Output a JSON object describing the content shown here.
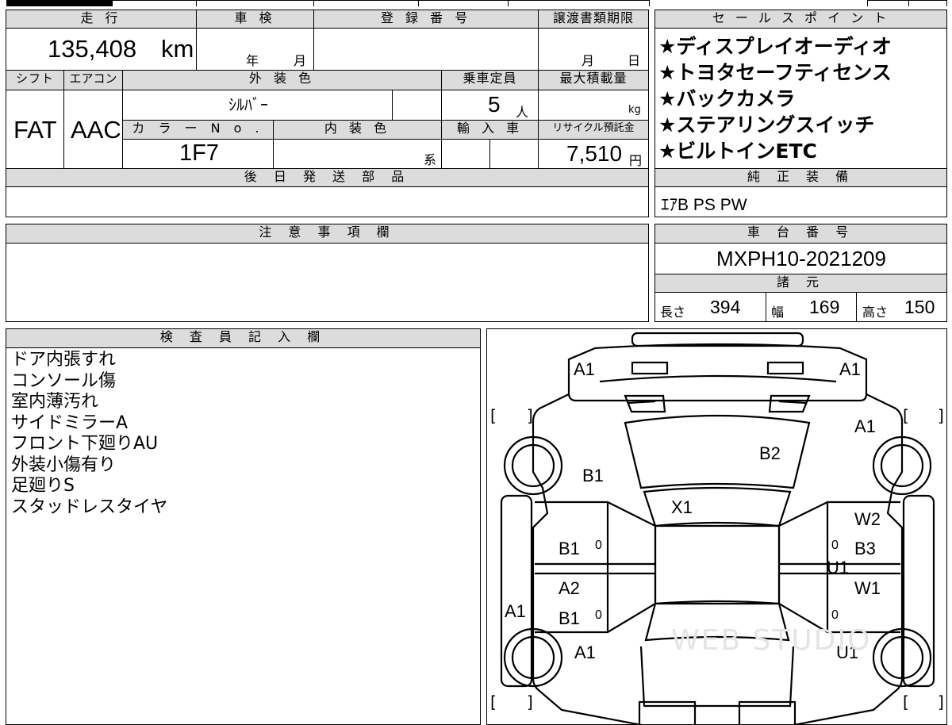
{
  "top_left": {
    "headers": {
      "mileage": "走 行",
      "inspection": "車 検",
      "registration": "登 録 番 号",
      "transfer_deadline": "譲渡書類期限",
      "shift": "シフト",
      "aircon": "エアコン",
      "exterior_color": "外 装 色",
      "capacity": "乗車定員",
      "max_load": "最大積載量",
      "color_no": "カ ラ ー N o .",
      "interior_color": "内 装 色",
      "import": "輸 入 車",
      "recycle": "リサイクル預託金",
      "later_parts": "後 日 発 送 部 品"
    },
    "values": {
      "mileage": "135,408",
      "mileage_unit": "km",
      "year_label": "年",
      "month_label": "月",
      "deadline_month": "月",
      "deadline_day": "日",
      "shift": "FAT",
      "aircon": "AAC",
      "exterior_color": "ｼﾙﾊﾞｰ",
      "capacity": "5",
      "capacity_unit": "人",
      "load_unit": "kg",
      "color_no": "1F7",
      "interior_suffix": "系",
      "recycle": "7,510",
      "recycle_unit": "円"
    }
  },
  "sale_points": {
    "header": "セ ー ル ス ポ イ ン ト",
    "items": [
      "★ディスプレイオーディオ",
      "★トヨタセーフティセンス",
      "★バックカメラ",
      "★ステアリングスイッチ",
      "★ビルトインETC"
    ]
  },
  "genuine_equipment": {
    "header": "純 正 装 備",
    "value": "ｴｱB PS PW"
  },
  "caution": {
    "header": "注 意 事 項 欄"
  },
  "chassis": {
    "header": "車 台 番 号",
    "value": "MXPH10-2021209"
  },
  "specs": {
    "header": "諸 元",
    "length_label": "長さ",
    "length": "394",
    "width_label": "幅",
    "width": "169",
    "height_label": "高さ",
    "height": "150"
  },
  "inspector": {
    "header": "検 査 員 記 入 欄",
    "notes": [
      "ドア内張すれ",
      "コンソール傷",
      "室内薄汚れ",
      "サイドミラーA",
      "フロント下廻りAU",
      "外装小傷有り",
      "足廻りS",
      "スタッドレスタイヤ"
    ]
  },
  "diagram": {
    "marks": {
      "front_left": "A1",
      "front_right": "A1",
      "front_right_fender": "A1",
      "hood": "B2",
      "left_fender": "B1",
      "windshield": "X1",
      "right_front_door_w": "W2",
      "left_front_door": "B1",
      "right_front_door": "B3",
      "right_sill": "U1",
      "left_rear_door_a": "A2",
      "left_rear_door_b": "B1",
      "right_rear_door": "W1",
      "left_sill": "A1",
      "left_rear_quarter": "A1",
      "right_rear_quarter": "U1"
    },
    "zero": "0",
    "bracket_open": "[",
    "bracket_close": "]",
    "watermark": "WEB STUDIO"
  }
}
